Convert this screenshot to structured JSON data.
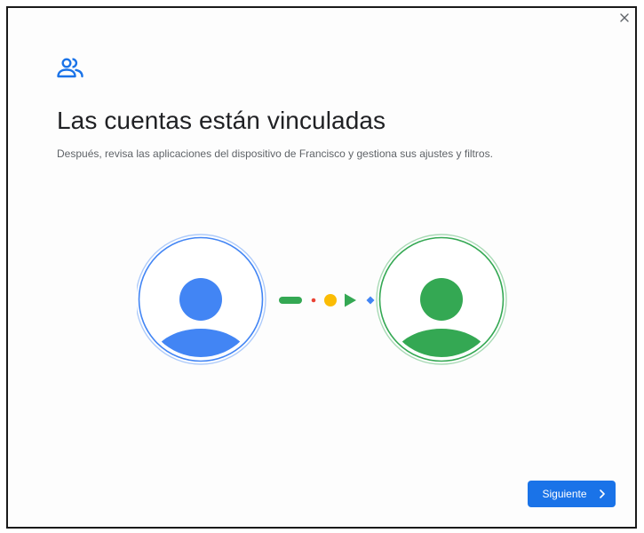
{
  "dialog": {
    "title": "Las cuentas están vinculadas",
    "subtitle": "Después, revisa las aplicaciones del dispositivo de Francisco y gestiona sus ajustes y filtros.",
    "next_button_label": "Siguiente",
    "close_icon": "close-icon",
    "header_icon": "people-icon",
    "forward_icon": "chevron-right-icon"
  },
  "illustration": {
    "left_avatar_color": "#4285f4",
    "right_avatar_color": "#34a853",
    "connector_colors": [
      "#34a853",
      "#ea4335",
      "#fbbc04",
      "#34a853",
      "#4285f4"
    ]
  },
  "colors": {
    "accent": "#1a73e8",
    "title_text": "#202124",
    "body_text": "#5f6368"
  }
}
